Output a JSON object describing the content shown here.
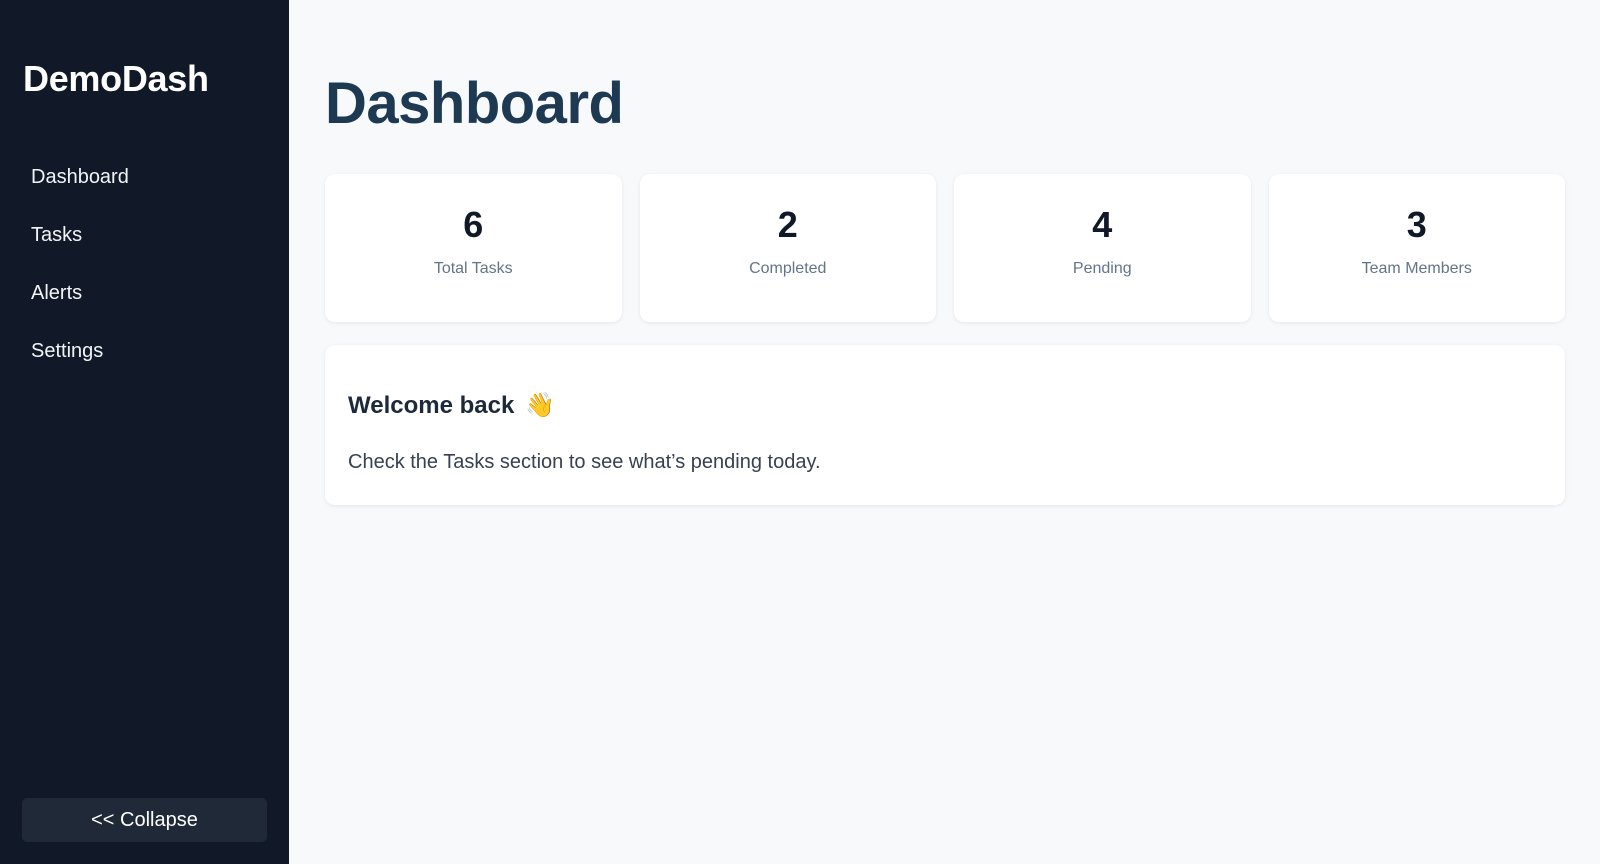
{
  "sidebar": {
    "brand": "DemoDash",
    "items": [
      {
        "label": "Dashboard"
      },
      {
        "label": "Tasks"
      },
      {
        "label": "Alerts"
      },
      {
        "label": "Settings"
      }
    ],
    "collapse_label": "<< Collapse"
  },
  "main": {
    "title": "Dashboard",
    "stats": [
      {
        "value": "6",
        "label": "Total Tasks"
      },
      {
        "value": "2",
        "label": "Completed"
      },
      {
        "value": "4",
        "label": "Pending"
      },
      {
        "value": "3",
        "label": "Team Members"
      }
    ],
    "welcome": {
      "title": "Welcome back",
      "icon": "waving-hand-icon",
      "message": "Check the Tasks section to see what’s pending today."
    }
  },
  "colors": {
    "sidebar_bg": "#111827",
    "page_bg": "#f7f9fb",
    "title": "#1e3a52",
    "collapse_bg": "#1f2937"
  }
}
